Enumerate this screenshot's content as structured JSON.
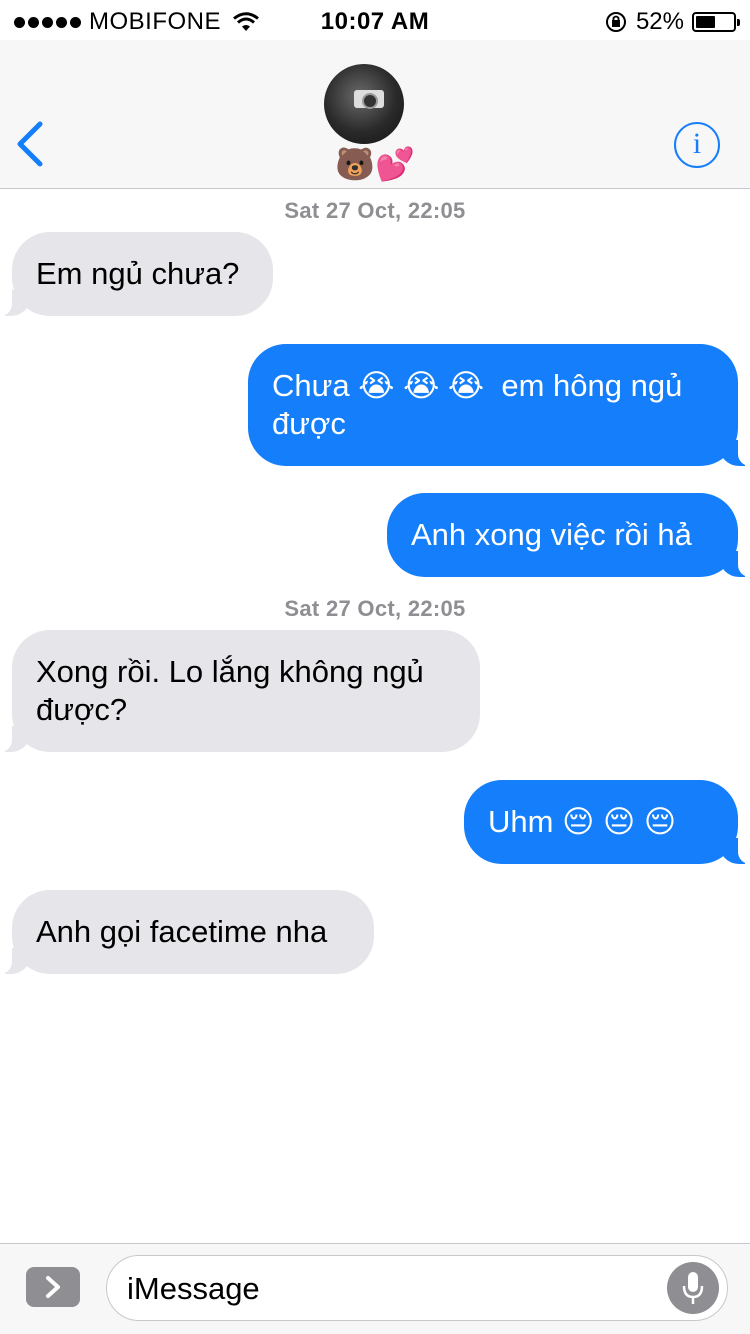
{
  "status_bar": {
    "carrier": "MOBIFONE",
    "time": "10:07 AM",
    "battery": "52%",
    "battery_level": 0.52
  },
  "header": {
    "contact_name": "🐻💕"
  },
  "messages": [
    {
      "kind": "timestamp",
      "text": "Sat 27 Oct, 22:05"
    },
    {
      "kind": "incoming",
      "text": "Em ngủ chưa?"
    },
    {
      "kind": "outgoing",
      "text": "Chưa 😭 😭 😭  em hông ngủ\nđược"
    },
    {
      "kind": "outgoing",
      "text": "Anh xong việc rồi hả"
    },
    {
      "kind": "timestamp",
      "text": "Sat 27 Oct, 22:05"
    },
    {
      "kind": "incoming",
      "text": "Xong rồi. Lo lắng không ngủ\nđược?"
    },
    {
      "kind": "outgoing",
      "text": "Uhm 😔 😔 😔"
    },
    {
      "kind": "incoming",
      "text": "Anh gọi facetime nha"
    }
  ],
  "input": {
    "placeholder": "iMessage"
  },
  "colors": {
    "accent": "#147efb",
    "incoming_bubble": "#e5e5ea",
    "timestamp": "#8e8e93"
  }
}
